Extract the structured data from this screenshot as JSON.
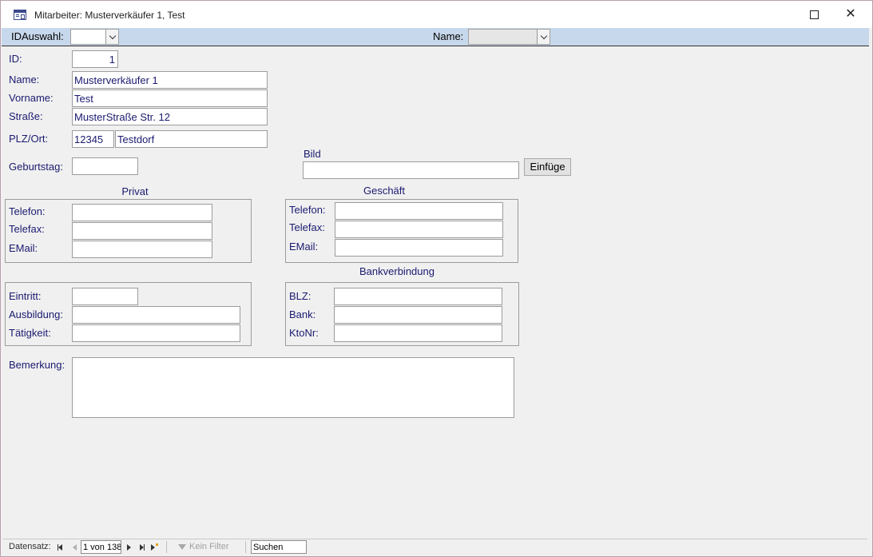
{
  "window": {
    "title": "Mitarbeiter: Musterverkäufer 1, Test",
    "maximize_label": "☐",
    "close_label": "✕"
  },
  "filterbar": {
    "id_label": "IDAuswahl:",
    "name_label": "Name:",
    "id_value": "",
    "name_value": ""
  },
  "form": {
    "id_label": "ID:",
    "id_value": "1",
    "name_label": "Name:",
    "name_value": "Musterverkäufer 1",
    "vorname_label": "Vorname:",
    "vorname_value": "Test",
    "strasse_label": "Straße:",
    "strasse_value": "MusterStraße Str. 12",
    "plzort_label": "PLZ/Ort:",
    "plz_value": "12345",
    "ort_value": "Testdorf",
    "geburtstag_label": "Geburtstag:",
    "geburtstag_value": "",
    "bild_label": "Bild",
    "bild_value": "",
    "einfuegen_label": "Einfüge"
  },
  "privat": {
    "title": "Privat",
    "telefon_label": "Telefon:",
    "telefax_label": "Telefax:",
    "email_label": "EMail:",
    "telefon_value": "",
    "telefax_value": "",
    "email_value": ""
  },
  "geschaeft": {
    "title": "Geschäft",
    "telefon_label": "Telefon:",
    "telefax_label": "Telefax:",
    "email_label": "EMail:",
    "telefon_value": "",
    "telefax_value": "",
    "email_value": ""
  },
  "job": {
    "eintritt_label": "Eintritt:",
    "ausbildung_label": "Ausbildung:",
    "taetigkeit_label": "Tätigkeit:",
    "eintritt_value": "",
    "ausbildung_value": "",
    "taetigkeit_value": ""
  },
  "bank": {
    "title": "Bankverbindung",
    "blz_label": "BLZ:",
    "bank_label": "Bank:",
    "ktonr_label": "KtoNr:",
    "blz_value": "",
    "bank_value": "",
    "ktonr_value": ""
  },
  "bemerkung": {
    "label": "Bemerkung:",
    "value": ""
  },
  "navbar": {
    "datensatz_label": "Datensatz:",
    "record_text": "1 von 138",
    "filter_label": "Kein Filter",
    "search_value": "Suchen"
  },
  "colors": {
    "label_text": "#1a1a70",
    "filterbar_bg": "#c8d8ec",
    "form_bg": "#f0f0f0"
  }
}
